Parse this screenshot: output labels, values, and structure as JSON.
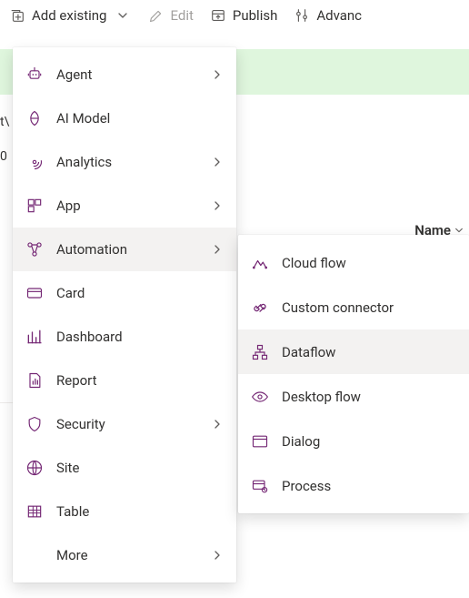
{
  "toolbar": {
    "add_existing": "Add existing",
    "edit": "Edit",
    "publish": "Publish",
    "advanced": "Advanc"
  },
  "column_header": "Name",
  "left_stub_top": "t\\",
  "left_stub_mid": "0",
  "menu": {
    "items": [
      {
        "label": "Agent",
        "has_sub": true
      },
      {
        "label": "AI Model",
        "has_sub": false
      },
      {
        "label": "Analytics",
        "has_sub": true
      },
      {
        "label": "App",
        "has_sub": true
      },
      {
        "label": "Automation",
        "has_sub": true
      },
      {
        "label": "Card",
        "has_sub": false
      },
      {
        "label": "Dashboard",
        "has_sub": false
      },
      {
        "label": "Report",
        "has_sub": false
      },
      {
        "label": "Security",
        "has_sub": true
      },
      {
        "label": "Site",
        "has_sub": false
      },
      {
        "label": "Table",
        "has_sub": false
      }
    ],
    "more": "More"
  },
  "submenu": {
    "items": [
      {
        "label": "Cloud flow"
      },
      {
        "label": "Custom connector"
      },
      {
        "label": "Dataflow"
      },
      {
        "label": "Desktop flow"
      },
      {
        "label": "Dialog"
      },
      {
        "label": "Process"
      }
    ]
  }
}
